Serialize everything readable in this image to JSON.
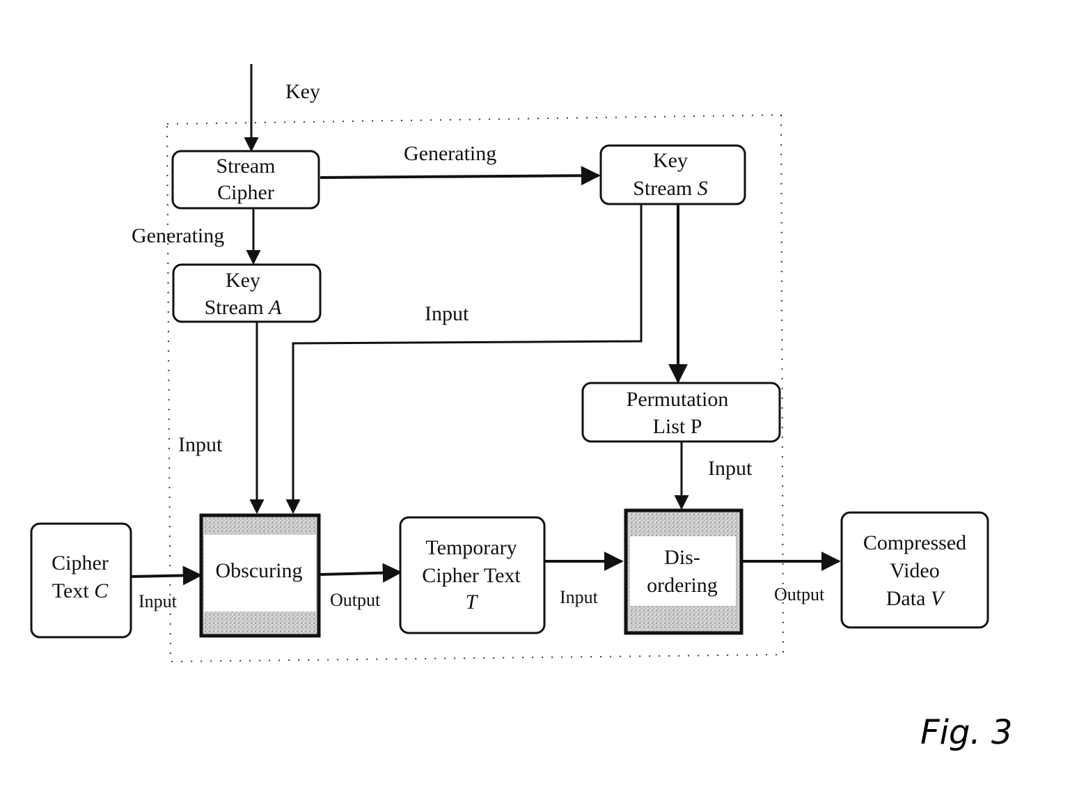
{
  "figure": {
    "label": "Fig. 3",
    "boundary": "dotted system boundary"
  },
  "nodes": {
    "stream_cipher": {
      "line1": "Stream",
      "line2": "Cipher"
    },
    "key_stream_a": {
      "line1": "Key",
      "line2": "Stream ",
      "var": "A"
    },
    "key_stream_s": {
      "line1": "Key",
      "line2": "Stream ",
      "var": "S"
    },
    "permutation_list": {
      "line1": "Permutation",
      "line2": "List P"
    },
    "cipher_text": {
      "line1": "Cipher",
      "line2": "Text ",
      "var": "C"
    },
    "obscuring": {
      "line1": "Obscuring"
    },
    "temporary_cipher_text": {
      "line1": "Temporary",
      "line2": "Cipher Text",
      "var": "T"
    },
    "disordering": {
      "line1": "Dis-",
      "line2": "ordering"
    },
    "compressed_video": {
      "line1": "Compressed",
      "line2": "Video",
      "line3": "Data ",
      "var": "V"
    }
  },
  "edges": {
    "key": "Key",
    "generating_top": "Generating",
    "generating_left": "Generating",
    "input_s_to_obscuring": "Input",
    "input_a_to_obscuring": "Input",
    "input_p_to_disordering": "Input",
    "input_c": "Input",
    "output_obscuring": "Output",
    "input_t": "Input",
    "output_disordering": "Output"
  }
}
